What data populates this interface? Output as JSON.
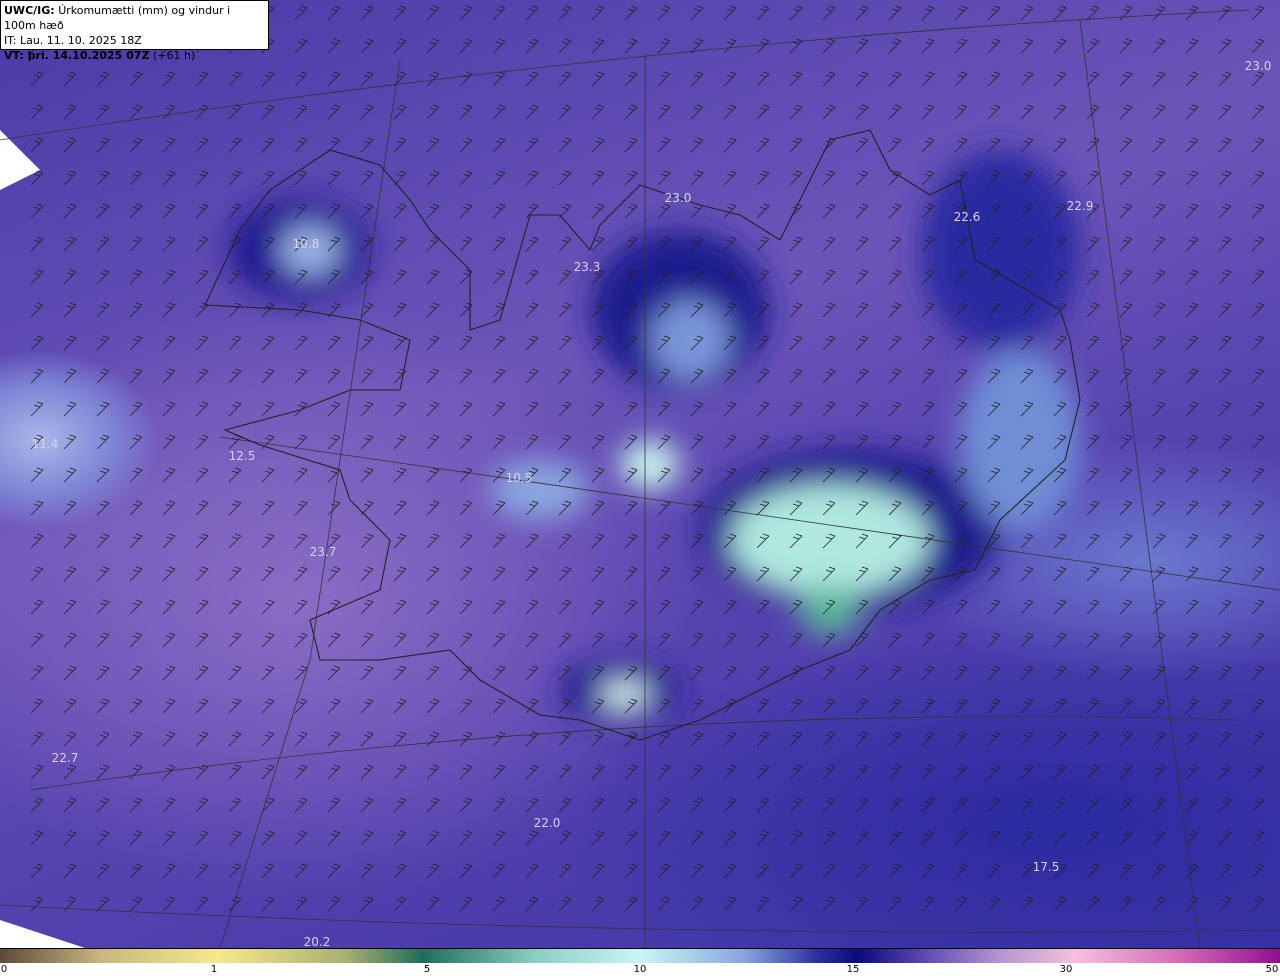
{
  "header": {
    "product": "UWC/IG:",
    "description": "Úrkomumætti (mm) og vindur i 100m hæð",
    "it": "IT: Lau. 11. 10. 2025 18Z",
    "vt_bold": "VT: þri. 14.10.2025 07Z",
    "vt_offset": "(+61 h)"
  },
  "map_labels": [
    {
      "text": "23.0",
      "place": "northeast-sea"
    },
    {
      "text": "23.0",
      "place": "north-coast"
    },
    {
      "text": "22.6",
      "place": "northeast"
    },
    {
      "text": "22.9",
      "place": "northeast-offshore"
    },
    {
      "text": "10.8",
      "place": "westfjords"
    },
    {
      "text": "23.3",
      "place": "north-central"
    },
    {
      "text": "11.4",
      "place": "west-sea"
    },
    {
      "text": "12.5",
      "place": "snaefellsnes"
    },
    {
      "text": "10.5",
      "place": "langjokull"
    },
    {
      "text": "23.7",
      "place": "faxafloi"
    },
    {
      "text": "22.7",
      "place": "southwest-sea"
    },
    {
      "text": "22.0",
      "place": "south-sea"
    },
    {
      "text": "17.5",
      "place": "southeast-sea"
    },
    {
      "text": "20.2",
      "place": "south-bottom"
    }
  ],
  "colorbar": {
    "ticks": [
      "0",
      "1",
      "5",
      "10",
      "15",
      "30",
      "50"
    ],
    "unit": "mm"
  },
  "colors": {
    "ocean": "#4a3aa8",
    "heavy": "#b8f0e8",
    "land_max": "#7fd0b8"
  }
}
